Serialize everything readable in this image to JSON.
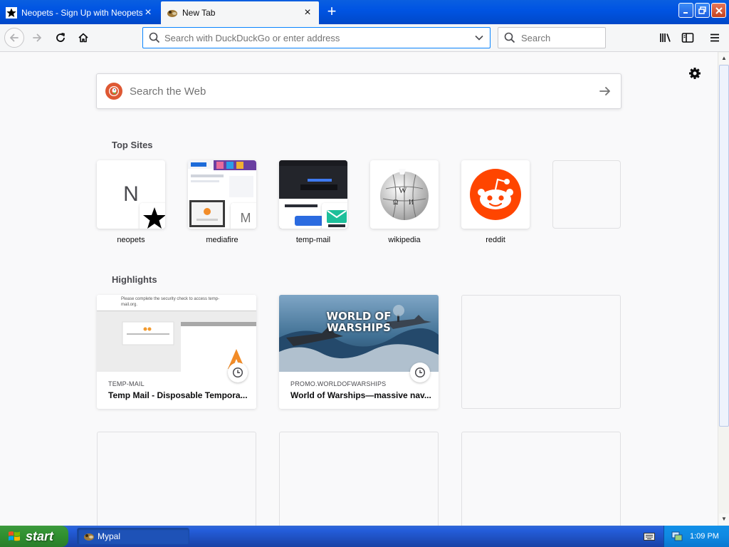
{
  "tabs": [
    {
      "title": "Neopets - Sign Up with Neopets (S",
      "active": false,
      "icon": "star-icon"
    },
    {
      "title": "New Tab",
      "active": true,
      "icon": "mypal-icon"
    }
  ],
  "toolbar": {
    "url_placeholder": "Search with DuckDuckGo or enter address",
    "search_placeholder": "Search"
  },
  "newtab": {
    "websearch_placeholder": "Search the Web",
    "top_sites_title": "Top Sites",
    "highlights_title": "Highlights",
    "top_sites": [
      {
        "label": "neopets",
        "letter": "N"
      },
      {
        "label": "mediafire",
        "letter": "M"
      },
      {
        "label": "temp-mail",
        "letter": ""
      },
      {
        "label": "wikipedia",
        "letter": ""
      },
      {
        "label": "reddit",
        "letter": ""
      },
      {
        "label": "",
        "letter": ""
      }
    ],
    "highlights": [
      {
        "source": "TEMP-MAIL",
        "title": "Temp Mail - Disposable Tempora...",
        "preview_text": "Please complete the security check to access temp-mail.org."
      },
      {
        "source": "PROMO.WORLDOFWARSHIPS",
        "title": "World of Warships—massive nav...",
        "preview_text": "WORLD OF WARSHIPS"
      }
    ]
  },
  "taskbar": {
    "start_label": "start",
    "task_label": "Mypal",
    "clock": "1:09 PM"
  },
  "colors": {
    "accent": "#0a84ff",
    "reddit": "#ff4500",
    "duckduckgo": "#de5833",
    "xp_blue": "#0054e3",
    "xp_green": "#3c9a3c"
  }
}
